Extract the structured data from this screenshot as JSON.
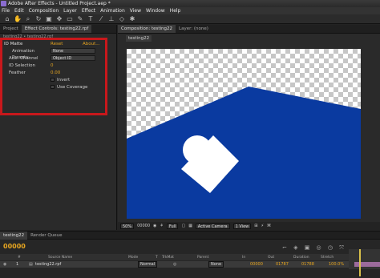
{
  "window": {
    "title": "Adobe After Effects - Untitled Project.aep *"
  },
  "menu": [
    "File",
    "Edit",
    "Composition",
    "Layer",
    "Effect",
    "Animation",
    "View",
    "Window",
    "Help"
  ],
  "toolbar": {
    "icons": [
      "home-icon",
      "hand-icon",
      "zoom-icon",
      "rotate-icon",
      "camera-icon",
      "pan-icon",
      "rect-icon",
      "pen-icon",
      "text-icon",
      "brush-icon",
      "stamp-icon",
      "eraser-icon",
      "puppet-icon"
    ]
  },
  "left_panel": {
    "tabs": [
      "Project",
      "Effect Controls: testing22.rpf"
    ],
    "path": "testing22 • testing22.rpf",
    "effect": {
      "name": "ID Matte",
      "reset": "Reset",
      "about": "About..."
    },
    "animation_presets": {
      "label": "Animation Presets:",
      "value": "None"
    },
    "aux_channel": {
      "label": "Aux. Channel",
      "value": "Object ID"
    },
    "id_selection": {
      "label": "ID Selection",
      "value": "0"
    },
    "feather": {
      "label": "Feather",
      "value": "0.00"
    },
    "invert": {
      "label": "Invert"
    },
    "use_coverage": {
      "label": "Use Coverage"
    }
  },
  "comp_panel": {
    "tab": "Composition: testing22",
    "layer_tab": "Layer: (none)",
    "comp_label": "testing22"
  },
  "viewer_bar": {
    "zoom": "50%",
    "timecode": "00000",
    "resolution": "Full",
    "camera": "Active Camera",
    "view": "1 View"
  },
  "timeline": {
    "tabs": [
      "testing22",
      "Render Queue"
    ],
    "timecode": "00000",
    "columns": [
      "#",
      "Source Name",
      "Mode",
      "T",
      "TrkMat",
      "Parent",
      "In",
      "Out",
      "Duration",
      "Stretch"
    ],
    "layer": {
      "number": "1",
      "name": "testing22.rpf",
      "mode": "Normal",
      "parent": "None",
      "in": "00000",
      "out": "01787",
      "duration": "01788",
      "stretch": "100.0%"
    }
  },
  "colors": {
    "accent": "#e6a520",
    "highlight": "#c8181c",
    "shape_blue": "#0a3aa0",
    "track": "#9c6b9c"
  }
}
